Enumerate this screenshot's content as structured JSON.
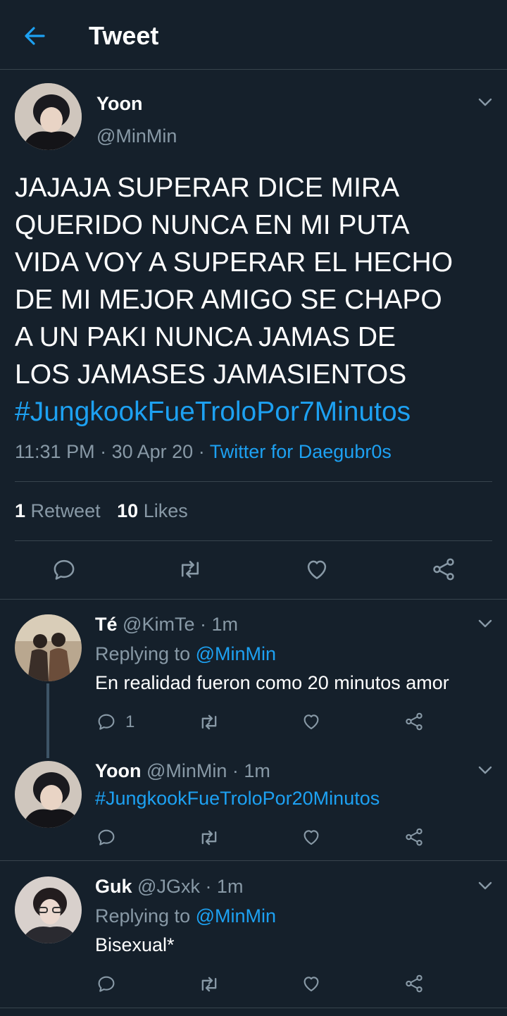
{
  "header": {
    "title": "Tweet"
  },
  "main_tweet": {
    "name": "Yoon",
    "handle": "@MinMin",
    "lines": [
      "JAJAJA SUPERAR DICE MIRA",
      "QUERIDO NUNCA EN MI PUTA",
      "VIDA VOY A SUPERAR EL HECHO",
      "DE MI MEJOR AMIGO SE CHAPO",
      "A UN PAKI NUNCA JAMAS DE",
      "LOS JAMASES JAMASIENTOS"
    ],
    "hashtag": "#JungkookFueTroloPor7Minutos",
    "time": "11:31 PM",
    "sep1": "·",
    "date": "30 Apr 20",
    "sep2": "·",
    "source": "Twitter for Daegubr0s",
    "retweets_count": "1",
    "retweets_label": "Retweet",
    "likes_count": "10",
    "likes_label": "Likes"
  },
  "replies": [
    {
      "name": "Té",
      "handle_time": "@KimTe · 1m",
      "replying_prefix": "Replying to",
      "replying_handle": "@MinMin",
      "text": "En realidad fueron como 20 minutos amor",
      "reply_count": "1"
    },
    {
      "name": "Yoon",
      "handle_time": "@MinMin · 1m",
      "text": "#JungkookFueTroloPor20Minutos"
    },
    {
      "name": "Guk",
      "handle_time": "@JGxk · 1m",
      "replying_prefix": "Replying to",
      "replying_handle": "@MinMin",
      "text": "Bisexual*"
    }
  ],
  "colors": {
    "background": "#15202b",
    "accent": "#1da1f2",
    "muted": "#8899a6",
    "divider": "#38444d"
  },
  "icons": [
    "back-arrow-icon",
    "chevron-down-icon",
    "reply-icon",
    "retweet-icon",
    "like-icon",
    "share-icon"
  ]
}
